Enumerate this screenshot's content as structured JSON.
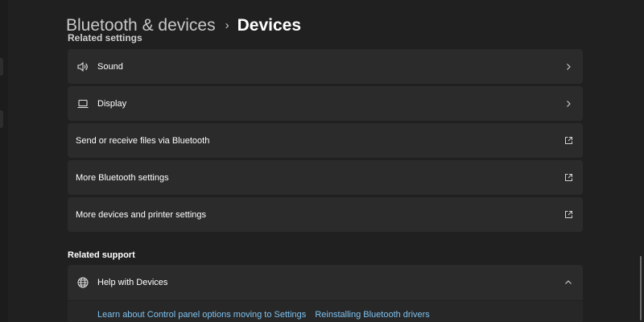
{
  "breadcrumb": {
    "parent": "Bluetooth & devices",
    "separator": "›",
    "current": "Devices"
  },
  "related_settings": {
    "header": "Related settings",
    "items": [
      {
        "label": "Sound",
        "icon": "speaker-icon",
        "trail": "chevron-right-icon"
      },
      {
        "label": "Display",
        "icon": "laptop-icon",
        "trail": "chevron-right-icon"
      },
      {
        "label": "Send or receive files via Bluetooth",
        "icon": "",
        "trail": "external-link-icon"
      },
      {
        "label": "More Bluetooth settings",
        "icon": "",
        "trail": "external-link-icon"
      },
      {
        "label": "More devices and printer settings",
        "icon": "",
        "trail": "external-link-icon"
      }
    ]
  },
  "related_support": {
    "header": "Related support",
    "card": {
      "label": "Help with Devices",
      "icon": "globe-icon",
      "trail": "chevron-up-icon"
    },
    "links": [
      "Learn about Control panel options moving to Settings",
      "Reinstalling Bluetooth drivers"
    ]
  },
  "colors": {
    "background": "#202020",
    "card": "#2b2b2b",
    "link": "#7fc3f0"
  }
}
